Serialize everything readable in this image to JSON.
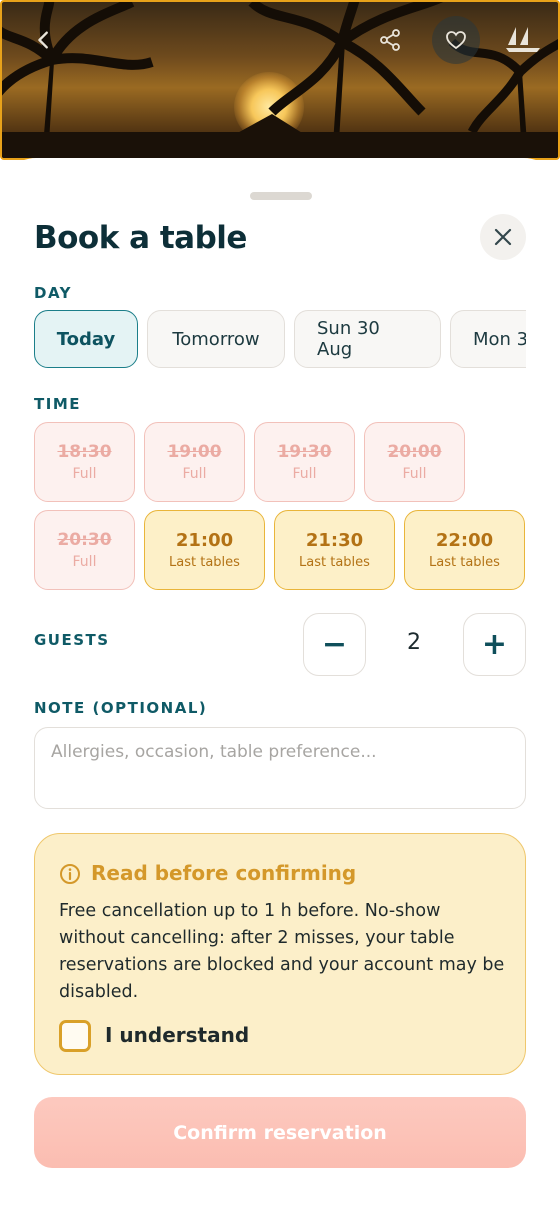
{
  "hero": {
    "back_icon": "chevron-left-icon",
    "share_icon": "share-icon",
    "favorite_icon": "heart-icon",
    "logo_icon": "sailboat-icon"
  },
  "sheet": {
    "title": "Book a table",
    "close_icon": "close-icon"
  },
  "day": {
    "label": "DAY",
    "options": [
      "Today",
      "Tomorrow",
      "Sun 30 Aug",
      "Mon 3"
    ],
    "selected": "Today"
  },
  "time": {
    "label": "TIME",
    "slots": [
      {
        "time": "18:30",
        "status": "Full"
      },
      {
        "time": "19:00",
        "status": "Full"
      },
      {
        "time": "19:30",
        "status": "Full"
      },
      {
        "time": "20:00",
        "status": "Full"
      },
      {
        "time": "20:30",
        "status": "Full"
      },
      {
        "time": "21:00",
        "status": "Last tables"
      },
      {
        "time": "21:30",
        "status": "Last tables"
      },
      {
        "time": "22:00",
        "status": "Last tables"
      }
    ]
  },
  "guests": {
    "label": "GUESTS",
    "count": "2",
    "minus": "−",
    "plus": "+"
  },
  "note": {
    "label": "NOTE (OPTIONAL)",
    "placeholder": "Allergies, occasion, table preference...",
    "value": ""
  },
  "notice": {
    "title": "Read before confirming",
    "icon": "info-icon",
    "text": "Free cancellation up to 1 h before. No-show without cancelling: after 2 misses, your table reservations are blocked and your account may be disabled.",
    "checkbox_label": "I understand",
    "checked": false
  },
  "confirm": {
    "label": "Confirm reservation"
  },
  "colors": {
    "accent": "#1b7e89",
    "full_slot": "#f2c1ba",
    "last_slot": "#e9b53a",
    "notice_bg": "#fcefc9",
    "confirm_disabled": "#fbbdb1"
  }
}
